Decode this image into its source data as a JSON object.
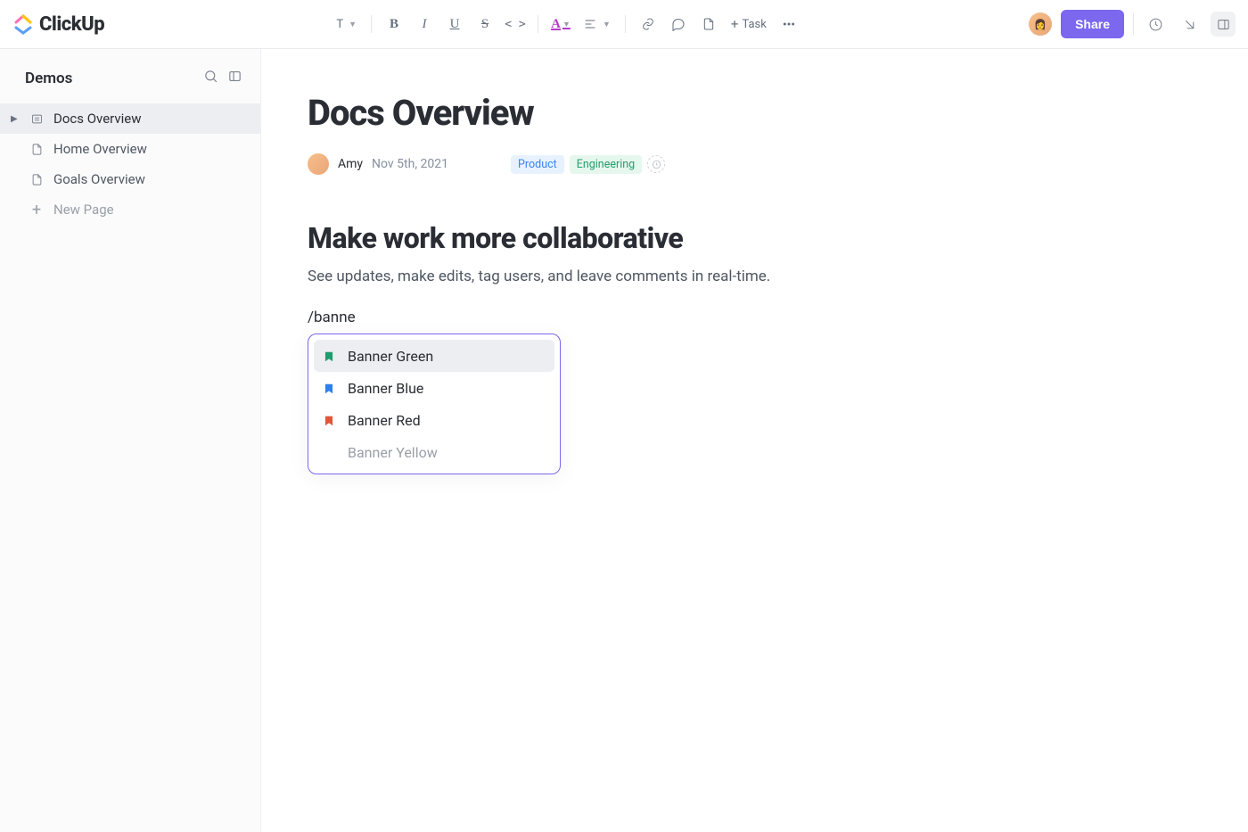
{
  "brand": "ClickUp",
  "toolbar": {
    "text_style_label": "T",
    "task_label": "Task",
    "share_label": "Share"
  },
  "sidebar": {
    "title": "Demos",
    "items": [
      {
        "label": "Docs Overview",
        "active": true,
        "type": "doc"
      },
      {
        "label": "Home Overview",
        "active": false,
        "type": "page"
      },
      {
        "label": "Goals Overview",
        "active": false,
        "type": "page"
      }
    ],
    "new_page_label": "New Page"
  },
  "doc": {
    "title": "Docs Overview",
    "author": "Amy",
    "date": "Nov 5th, 2021",
    "tags": [
      {
        "label": "Product",
        "style": "product"
      },
      {
        "label": "Engineering",
        "style": "eng"
      }
    ],
    "heading": "Make work more collaborative",
    "paragraph": "See updates, make edits, tag users, and leave comments in real-time.",
    "slash_query": "/banne"
  },
  "slash_menu": {
    "items": [
      {
        "label": "Banner Green",
        "color": "#1f9d6e",
        "selected": true
      },
      {
        "label": "Banner Blue",
        "color": "#2f80ed",
        "selected": false
      },
      {
        "label": "Banner Red",
        "color": "#e2553d",
        "selected": false
      },
      {
        "label": "Banner Yellow",
        "color": "",
        "selected": false,
        "dim": true
      }
    ]
  }
}
